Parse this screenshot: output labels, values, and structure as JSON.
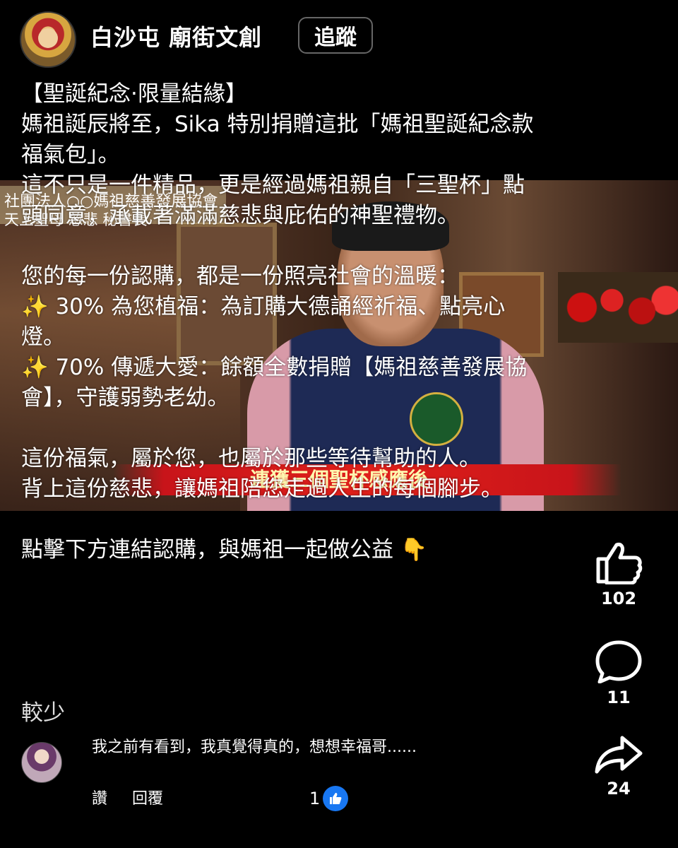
{
  "header": {
    "page_name": "白沙屯 廟街文創",
    "follow_label": "追蹤"
  },
  "post": {
    "lines": [
      "【聖誕紀念·限量結緣】",
      "媽祖誕辰將至，Sika 特別捐贈這批「媽祖聖誕紀念款福氣包」。",
      "這不只是一件精品，更是經過媽祖親自「三聖杯」點頭同意，承載著滿滿慈悲與庇佑的神聖禮物。",
      "",
      "您的每一份認購，都是一份照亮社會的溫暖：",
      "✨ 30% 為您植福：為訂購大德誦經祈福、點亮心燈。",
      "✨ 70% 傳遞大愛：餘額全數捐贈【媽祖慈善發展協會】，守護弱勢老幼。",
      "",
      "這份福氣，屬於您，也屬於那些等待幫助的人。",
      "背上這份慈悲，讓媽祖陪您走過人生的每個腳步。",
      "",
      "點擊下方連結認購，與媽祖一起做公益 👇"
    ],
    "see_less": "較少"
  },
  "video": {
    "overlay_tag_1": "社團法人○○媽祖慈善發展協會",
    "overlay_tag_2": "天上聖母 慈悲 秘書長",
    "caption": "連獲三個聖杯感應後"
  },
  "actions": {
    "like_count": "102",
    "comment_count": "11",
    "share_count": "24"
  },
  "comment": {
    "text": "我之前有看到，我真覺得真的，想想幸福哥......",
    "like_label": "讚",
    "reply_label": "回覆",
    "reaction_count": "1"
  },
  "colors": {
    "background": "#000000",
    "like_badge": "#1877f2",
    "caption_bar": "#e0201a"
  },
  "icons": [
    "thumbs-up-icon",
    "comment-bubble-icon",
    "share-arrow-icon",
    "like-badge-icon"
  ]
}
